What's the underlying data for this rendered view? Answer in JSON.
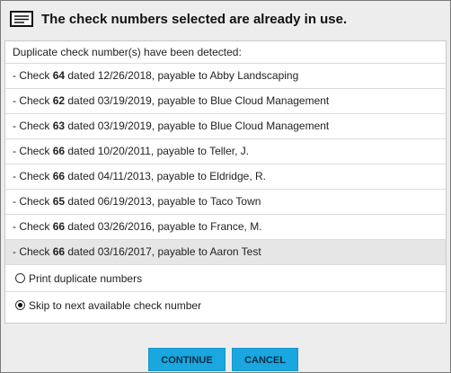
{
  "dialog": {
    "title": "The check numbers selected are already in use.",
    "icon": "list-window-icon"
  },
  "panel": {
    "header": "Duplicate check number(s) have been detected:",
    "checks": [
      {
        "prefix": "- Check ",
        "number": "64",
        "suffix": " dated 12/26/2018, payable to Abby Landscaping",
        "selected": false
      },
      {
        "prefix": "- Check ",
        "number": "62",
        "suffix": " dated 03/19/2019, payable to Blue Cloud Management",
        "selected": false
      },
      {
        "prefix": "- Check ",
        "number": "63",
        "suffix": " dated 03/19/2019, payable to Blue Cloud Management",
        "selected": false
      },
      {
        "prefix": "- Check ",
        "number": "66",
        "suffix": " dated 10/20/2011, payable to Teller, J.",
        "selected": false
      },
      {
        "prefix": "- Check ",
        "number": "66",
        "suffix": " dated 04/11/2013, payable to Eldridge, R.",
        "selected": false
      },
      {
        "prefix": "- Check ",
        "number": "65",
        "suffix": " dated 06/19/2013, payable to Taco Town",
        "selected": false
      },
      {
        "prefix": "- Check ",
        "number": "66",
        "suffix": " dated 03/26/2016, payable to France, M.",
        "selected": false
      },
      {
        "prefix": "- Check ",
        "number": "66",
        "suffix": " dated 03/16/2017, payable to Aaron Test",
        "selected": true
      }
    ],
    "options": [
      {
        "label": "Print duplicate numbers",
        "checked": false
      },
      {
        "label": "Skip to next available check number",
        "checked": true
      }
    ]
  },
  "buttons": {
    "continue_label": "CONTINUE",
    "cancel_label": "CANCEL"
  },
  "colors": {
    "button_bg": "#1aa7df",
    "button_text": "#0e2d44",
    "selected_row": "#e6e6e6"
  }
}
